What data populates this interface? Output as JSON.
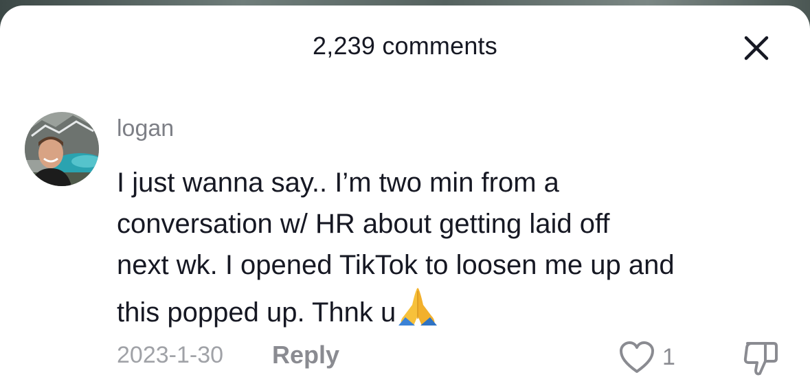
{
  "header": {
    "title": "2,239 comments",
    "close_icon": "close-icon"
  },
  "comment": {
    "username": "logan",
    "text_lines": [
      "I just wanna say.. I’m two min from a",
      "conversation w/ HR about getting laid off",
      "next wk. I opened TikTok to loosen me up and",
      "this popped up. Thnk u"
    ],
    "emoji": "folded-hands-emoji",
    "date": "2023-1-30",
    "reply_label": "Reply",
    "like_count": "1",
    "like_icon": "heart-outline-icon",
    "dislike_icon": "thumbs-down-icon"
  },
  "colors": {
    "text_primary": "#161823",
    "text_secondary": "#7d7f86",
    "text_tertiary": "#a0a2a7",
    "sheet_bg": "#ffffff"
  }
}
